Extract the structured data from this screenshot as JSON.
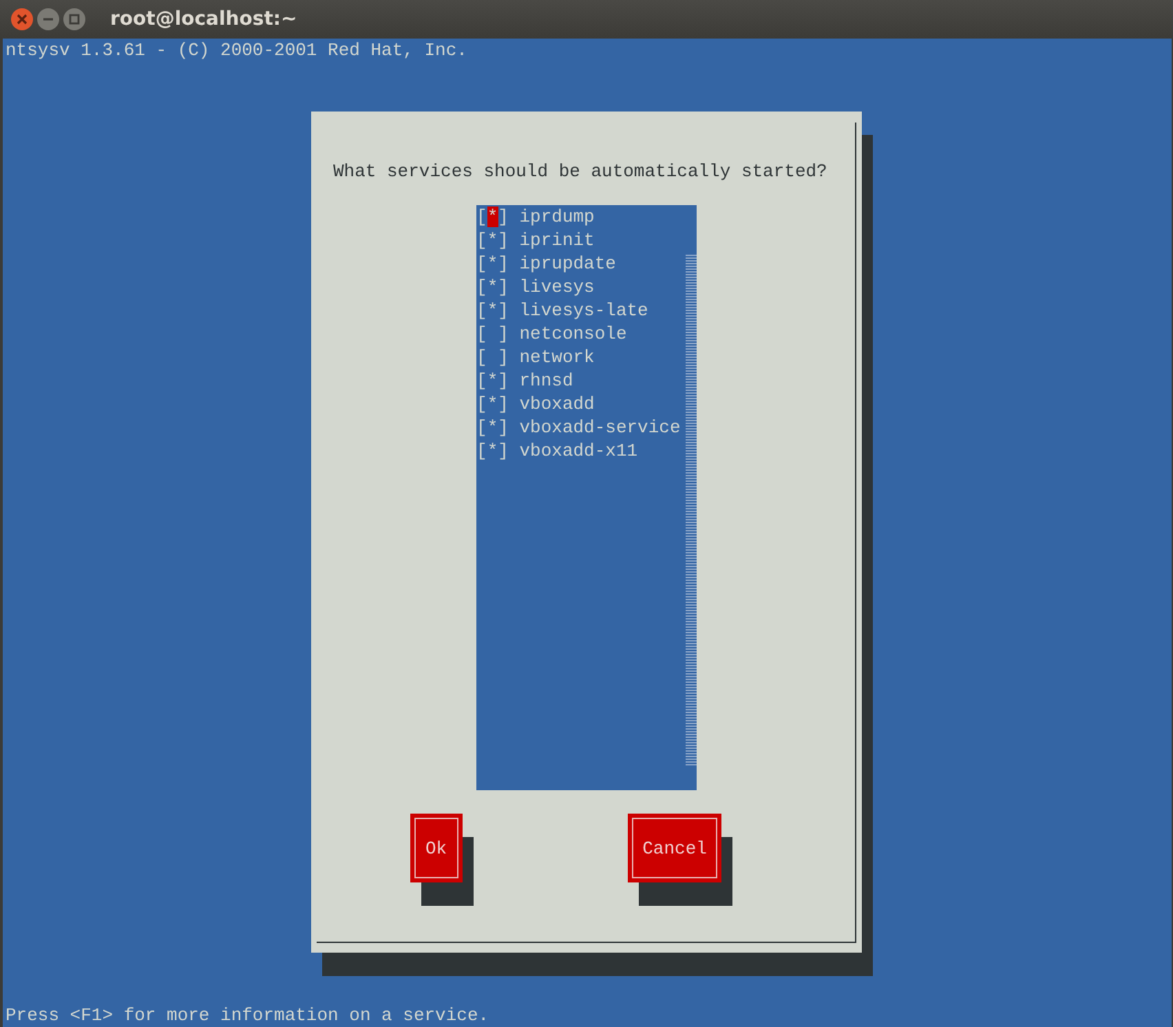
{
  "window": {
    "title": "root@localhost:~"
  },
  "header": "ntsysv 1.3.61 - (C) 2000-2001 Red Hat, Inc.",
  "dialog": {
    "question": "What services should be automatically started?",
    "checkbox": {
      "open": "[",
      "close": "]",
      "mark": "*"
    },
    "items": [
      {
        "label": "iprdump",
        "checked": true,
        "focused": true
      },
      {
        "label": "iprinit",
        "checked": true,
        "focused": false
      },
      {
        "label": "iprupdate",
        "checked": true,
        "focused": false
      },
      {
        "label": "livesys",
        "checked": true,
        "focused": false
      },
      {
        "label": "livesys-late",
        "checked": true,
        "focused": false
      },
      {
        "label": "netconsole",
        "checked": false,
        "focused": false
      },
      {
        "label": "network",
        "checked": false,
        "focused": false
      },
      {
        "label": "rhnsd",
        "checked": true,
        "focused": false
      },
      {
        "label": "vboxadd",
        "checked": true,
        "focused": false
      },
      {
        "label": "vboxadd-service",
        "checked": true,
        "focused": false
      },
      {
        "label": "vboxadd-x11",
        "checked": true,
        "focused": false
      }
    ],
    "buttons": [
      "Ok",
      "Cancel"
    ]
  },
  "status_bar": "Press <F1> for more information on a service."
}
